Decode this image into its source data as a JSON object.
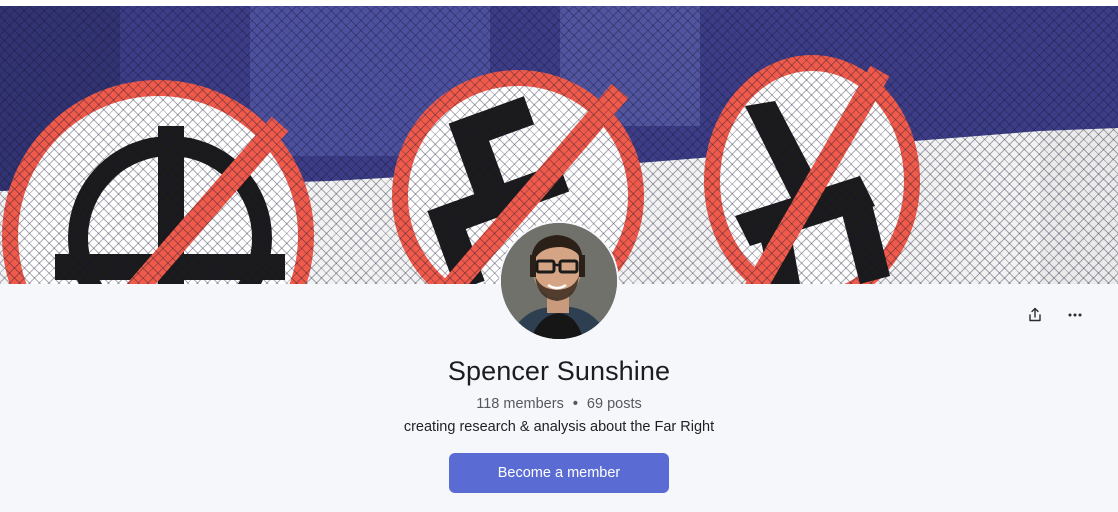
{
  "profile": {
    "name": "Spencer Sunshine",
    "members": "118 members",
    "separator": "•",
    "posts": "69 posts",
    "tagline": "creating research & analysis about the Far Right"
  },
  "actions": {
    "cta_label": "Become a member",
    "share_icon": "share-icon",
    "more_icon": "more-horizontal-icon"
  },
  "colors": {
    "accent": "#5a6bd3",
    "background": "#f6f7fb",
    "title": "#1c1d21"
  }
}
